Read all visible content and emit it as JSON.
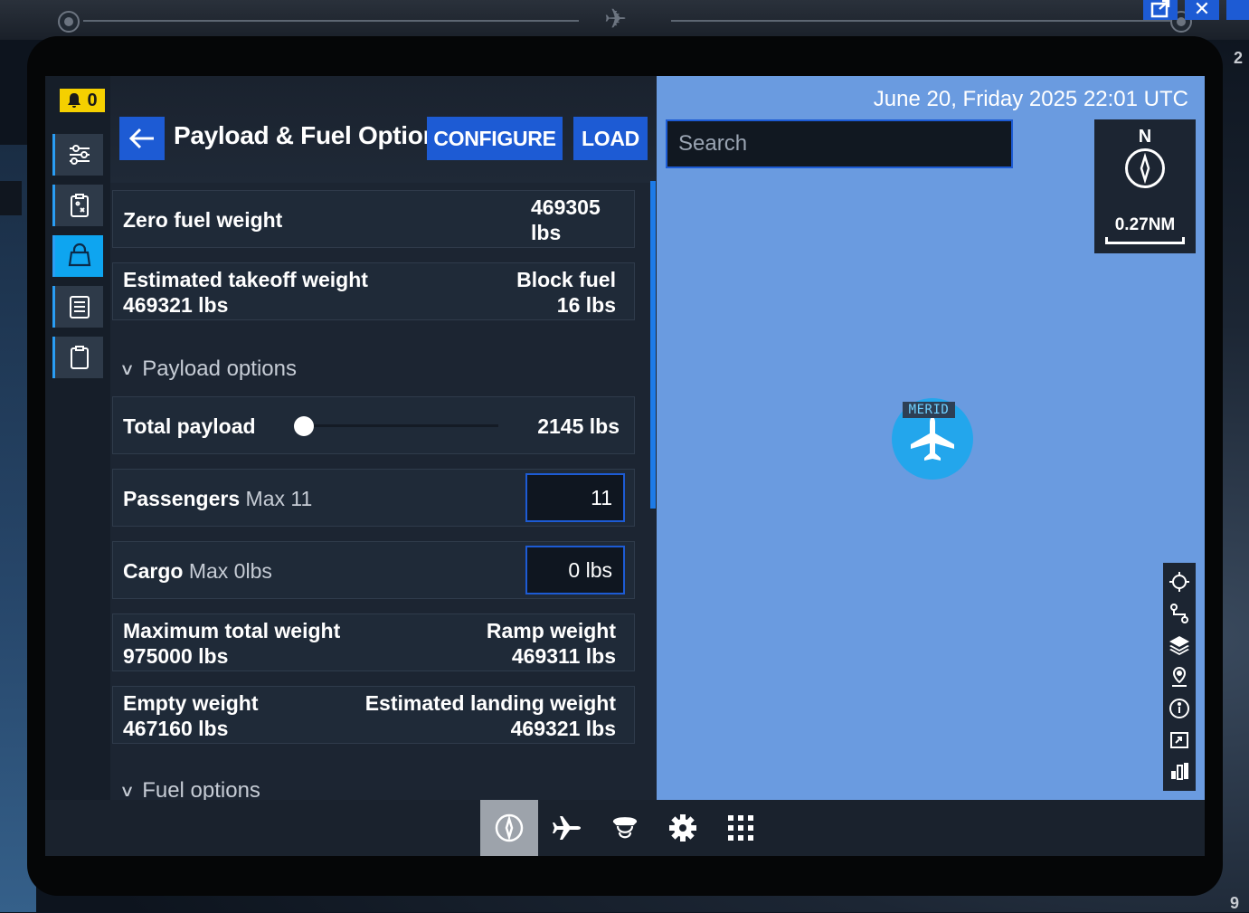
{
  "backdrop": {
    "edge_number_top": "2",
    "edge_number_bottom": "9"
  },
  "topbar": {
    "popout_icon": "external-link-icon",
    "close_icon": "close-icon"
  },
  "notifications": {
    "count": "0"
  },
  "rail": {
    "items": [
      {
        "name": "settings-sliders-icon",
        "active": false
      },
      {
        "name": "clipboard-checklist-icon",
        "active": false
      },
      {
        "name": "payload-weight-icon",
        "active": true
      },
      {
        "name": "document-list-icon",
        "active": false
      },
      {
        "name": "clipboard-icon",
        "active": false
      }
    ]
  },
  "header": {
    "title": "Payload & Fuel Options",
    "configure_label": "CONFIGURE",
    "load_label": "LOAD"
  },
  "summary": {
    "zero_fuel_weight_label": "Zero fuel weight",
    "zero_fuel_weight_value": "469305",
    "zero_fuel_weight_unit": "lbs",
    "est_takeoff_label": "Estimated takeoff weight",
    "est_takeoff_value": "469321 lbs",
    "block_fuel_label": "Block fuel",
    "block_fuel_value": "16 lbs"
  },
  "payload": {
    "section_label": "Payload options",
    "total_label": "Total payload",
    "total_value": "2145 lbs",
    "slider_fraction": 0.0,
    "passengers_label": "Passengers",
    "passengers_max": "Max 11",
    "passengers_value": "11",
    "cargo_label": "Cargo",
    "cargo_max": "Max 0lbs",
    "cargo_value": "0 lbs"
  },
  "weights": {
    "max_total_label": "Maximum total weight",
    "max_total_value": "975000 lbs",
    "ramp_label": "Ramp weight",
    "ramp_value": "469311 lbs",
    "empty_label": "Empty weight",
    "empty_value": "467160 lbs",
    "est_landing_label": "Estimated landing weight",
    "est_landing_value": "469321 lbs"
  },
  "fuel": {
    "section_label": "Fuel options"
  },
  "map": {
    "datetime": "June 20, Friday 2025 22:01 UTC",
    "search_placeholder": "Search",
    "compass_label": "N",
    "scale_label": "0.27NM",
    "aircraft_tag": "MERID",
    "background_color": "#6a9be0",
    "tools": [
      "crosshair-icon",
      "route-icon",
      "layers-icon",
      "map-pin-icon",
      "info-icon",
      "expand-icon",
      "chart-icon"
    ]
  },
  "bottom_nav": {
    "items": [
      {
        "name": "compass-nav-icon",
        "active": true
      },
      {
        "name": "airplane-nav-icon",
        "active": false
      },
      {
        "name": "pilot-nav-icon",
        "active": false
      },
      {
        "name": "gear-nav-icon",
        "active": false
      },
      {
        "name": "apps-grid-icon",
        "active": false
      }
    ]
  }
}
